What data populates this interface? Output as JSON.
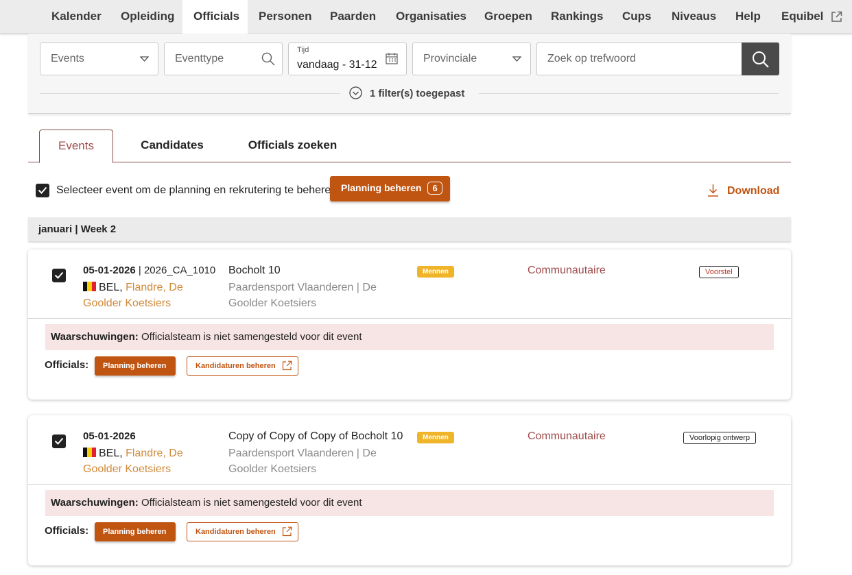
{
  "nav": {
    "items": [
      {
        "label": "Kalender",
        "active": false
      },
      {
        "label": "Opleiding",
        "active": false
      },
      {
        "label": "Officials",
        "active": true
      },
      {
        "label": "Personen",
        "active": false
      },
      {
        "label": "Paarden",
        "active": false
      },
      {
        "label": "Organisaties",
        "active": false
      },
      {
        "label": "Groepen",
        "active": false
      },
      {
        "label": "Rankings",
        "active": false
      },
      {
        "label": "Cups",
        "active": false
      },
      {
        "label": "Niveaus",
        "active": false
      },
      {
        "label": "Help",
        "active": false
      },
      {
        "label": "Equibel",
        "active": false,
        "icon": "external-link-icon"
      }
    ]
  },
  "filters": {
    "events": "Events",
    "eventtype_placeholder": "Eventtype",
    "tijd_label": "Tijd",
    "tijd_value": "vandaag - 31-12",
    "region": "Provinciale",
    "keyword_placeholder": "Zoek op trefwoord",
    "applied": "1 filter(s) toegepast"
  },
  "tabs": [
    {
      "label": "Events",
      "active": true
    },
    {
      "label": "Candidates",
      "active": false
    },
    {
      "label": "Officials zoeken",
      "active": false
    }
  ],
  "selection": {
    "label": "Selecteer event om de planning en rekrutering te beheren",
    "checked": true,
    "button_label": "Planning beheren",
    "count": "6",
    "download_label": "Download"
  },
  "week_header": "januari | Week 2",
  "events": [
    {
      "date": "05-01-2026",
      "code": "2026_CA_1010",
      "country": "BEL",
      "club": "Flandre, De Goolder Koetsiers",
      "title": "Bocholt 10",
      "organisation": "Paardensport Vlaanderen | De Goolder Koetsiers",
      "discipline": "Mennen",
      "level": "Communautaire",
      "status": "Voorstel",
      "warning_label": "Waarschuwingen:",
      "warning_text": "Officialsteam is niet samengesteld voor dit event",
      "officials_label": "Officials:",
      "planning_button": "Planning beheren",
      "candidates_button": "Kandidaturen beheren"
    },
    {
      "date": "05-01-2026",
      "code": "",
      "country": "BEL",
      "club": "Flandre, De Goolder Koetsiers",
      "title": "Copy of Copy of Copy of Bocholt 10",
      "organisation": "Paardensport Vlaanderen | De Goolder Koetsiers",
      "discipline": "Mennen",
      "level": "Communautaire",
      "status": "Voorlopig ontwerp",
      "warning_label": "Waarschuwingen:",
      "warning_text": "Officialsteam is niet samengesteld voor dit event",
      "officials_label": "Officials:",
      "planning_button": "Planning beheren",
      "candidates_button": "Kandidaturen beheren"
    }
  ],
  "colors": {
    "accent": "#c05512",
    "tab_active": "#a04a4a",
    "discipline_badge": "#f0b429",
    "warning_bg": "#f7e4e4"
  }
}
